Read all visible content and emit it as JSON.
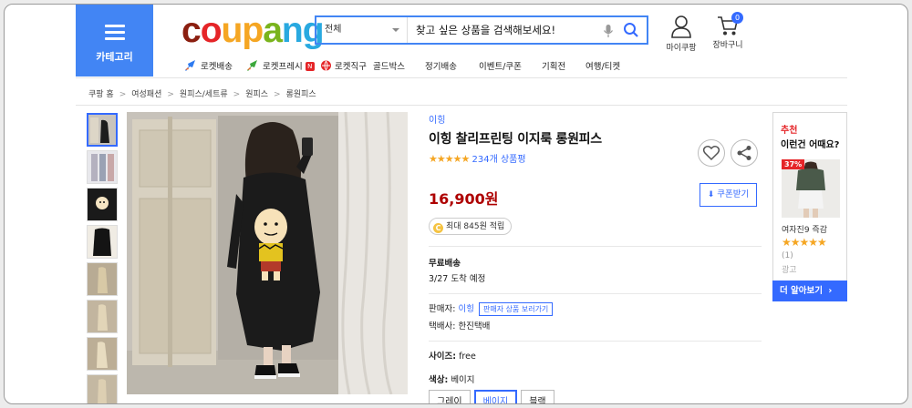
{
  "header": {
    "category_label": "카테고리",
    "logo": [
      "c",
      "o",
      "u",
      "p",
      "a",
      "n",
      "g"
    ],
    "logo_colors": [
      "#8b1f10",
      "#e52528",
      "#f5a623",
      "#f5a623",
      "#7ab41d",
      "#29a9e0",
      "#29a9e0"
    ],
    "search": {
      "category": "전체",
      "placeholder": "찾고 싶은 상품을 검색해보세요!"
    },
    "mycoupang": "마이쿠팡",
    "cart": "장바구니",
    "cart_count": "0",
    "menu": [
      "로켓배송",
      "로켓프레시",
      "로켓직구",
      "골드박스",
      "정기배송",
      "이벤트/쿠폰",
      "기획전",
      "여행/티켓"
    ],
    "fresh_badge": "N"
  },
  "breadcrumb": [
    "쿠팡 홈",
    "여성패션",
    "원피스/세트류",
    "원피스",
    "롱원피스"
  ],
  "product": {
    "brand": "이힝",
    "title": "이힝 찰리프린팅 이지룩 롱원피스",
    "stars": "★★★★★",
    "reviews": "234개 상품평",
    "price": "16,900원",
    "reward": "최대 845원 적립",
    "coin": "C",
    "coupon_button": "쿠폰받기",
    "shipping_title": "무료배송",
    "arrival": "3/27 도착 예정",
    "seller_label": "판매자:",
    "seller": "이힝",
    "seller_link": "판매자 상품 보러가기",
    "courier": "택배사: 한진택배",
    "size_label": "사이즈:",
    "size_value": "free",
    "color_label": "색상:",
    "color_value": "베이지",
    "color_options": [
      "그레이",
      "베이지",
      "블랙"
    ],
    "selected_color_index": 1
  },
  "recommend": {
    "label": "추천",
    "title": "이런건 어때요?",
    "discount": "37%",
    "name": "여자진9 즉감",
    "stars": "★★★★★",
    "count": "(1)",
    "ad": "광고",
    "more": "더 알아보기"
  },
  "colors": {
    "accent": "#346aff",
    "category_bg": "#4285f4",
    "price": "#ae0000"
  }
}
